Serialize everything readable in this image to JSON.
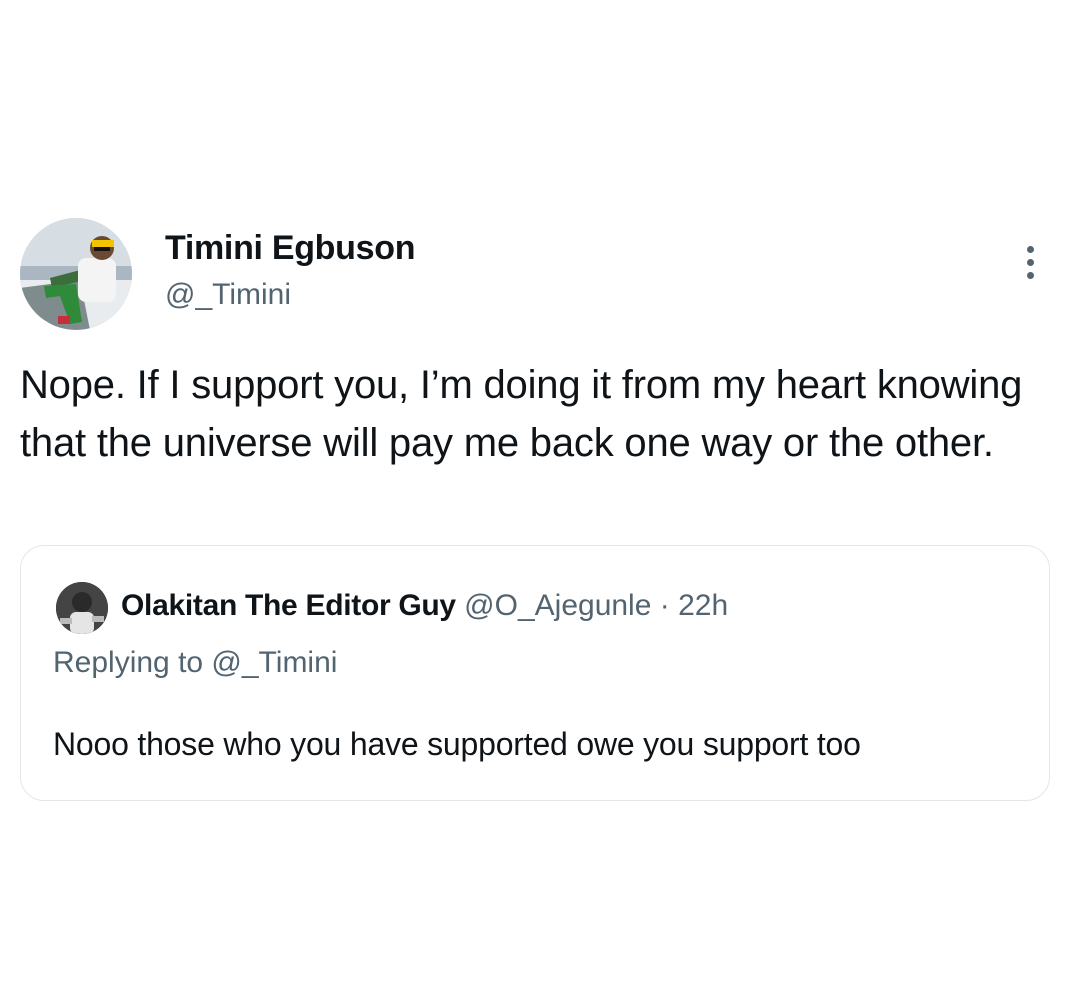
{
  "tweet": {
    "author": {
      "name": "Timini Egbuson",
      "handle": "@_Timini"
    },
    "text": "Nope. If I support you, I’m doing it from my heart knowing that the universe will pay me back one way or the other.",
    "more_icon": "more-vertical-icon"
  },
  "quoted_tweet": {
    "author": {
      "name": "Olakitan The Editor Guy",
      "handle": "@O_Ajegunle",
      "separator": " · ",
      "time": "22h"
    },
    "replying_to": "Replying to @_Timini",
    "text": "Nooo those who you have supported owe you support too"
  },
  "colors": {
    "text_primary": "#0f1419",
    "text_secondary": "#536471",
    "border": "#e3e6e9"
  }
}
